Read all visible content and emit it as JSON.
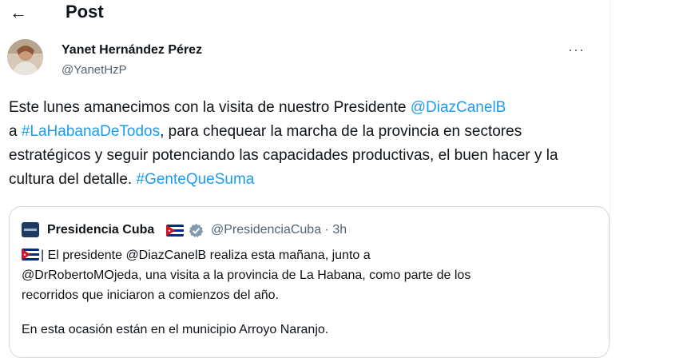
{
  "header": {
    "back_icon": "arrow-left-icon",
    "title": "Post"
  },
  "author": {
    "name": "Yanet Hernández Pérez",
    "handle": "@YanetHzP",
    "more_label": "···"
  },
  "post": {
    "t1": "Este lunes amanecimos con la visita de nuestro Presidente ",
    "mention": "@DiazCanelB",
    "t2": "a ",
    "hashtag1": "#LaHabanaDeTodos",
    "t3": ", para chequear la marcha de la provincia en sectores estratégicos y seguir potenciando las capacidades productivas, el buen hacer y la cultura del detalle. ",
    "hashtag2": "#GenteQueSuma"
  },
  "quote": {
    "name": "Presidencia Cuba",
    "handle_time": "@PresidenciaCuba · 3h",
    "line1": "| El presidente @DiazCanelB realiza esta mañana, junto a",
    "line2": "@DrRobertoMOjeda, una visita a la provincia de La Habana, como parte de los",
    "line3": "recorridos que iniciaron a comienzos del año.",
    "line4": "En esta ocasión están en el municipio Arroyo Naranjo."
  },
  "colors": {
    "link": "#1d9bf0",
    "muted": "#536471",
    "border": "#cfd9de"
  }
}
